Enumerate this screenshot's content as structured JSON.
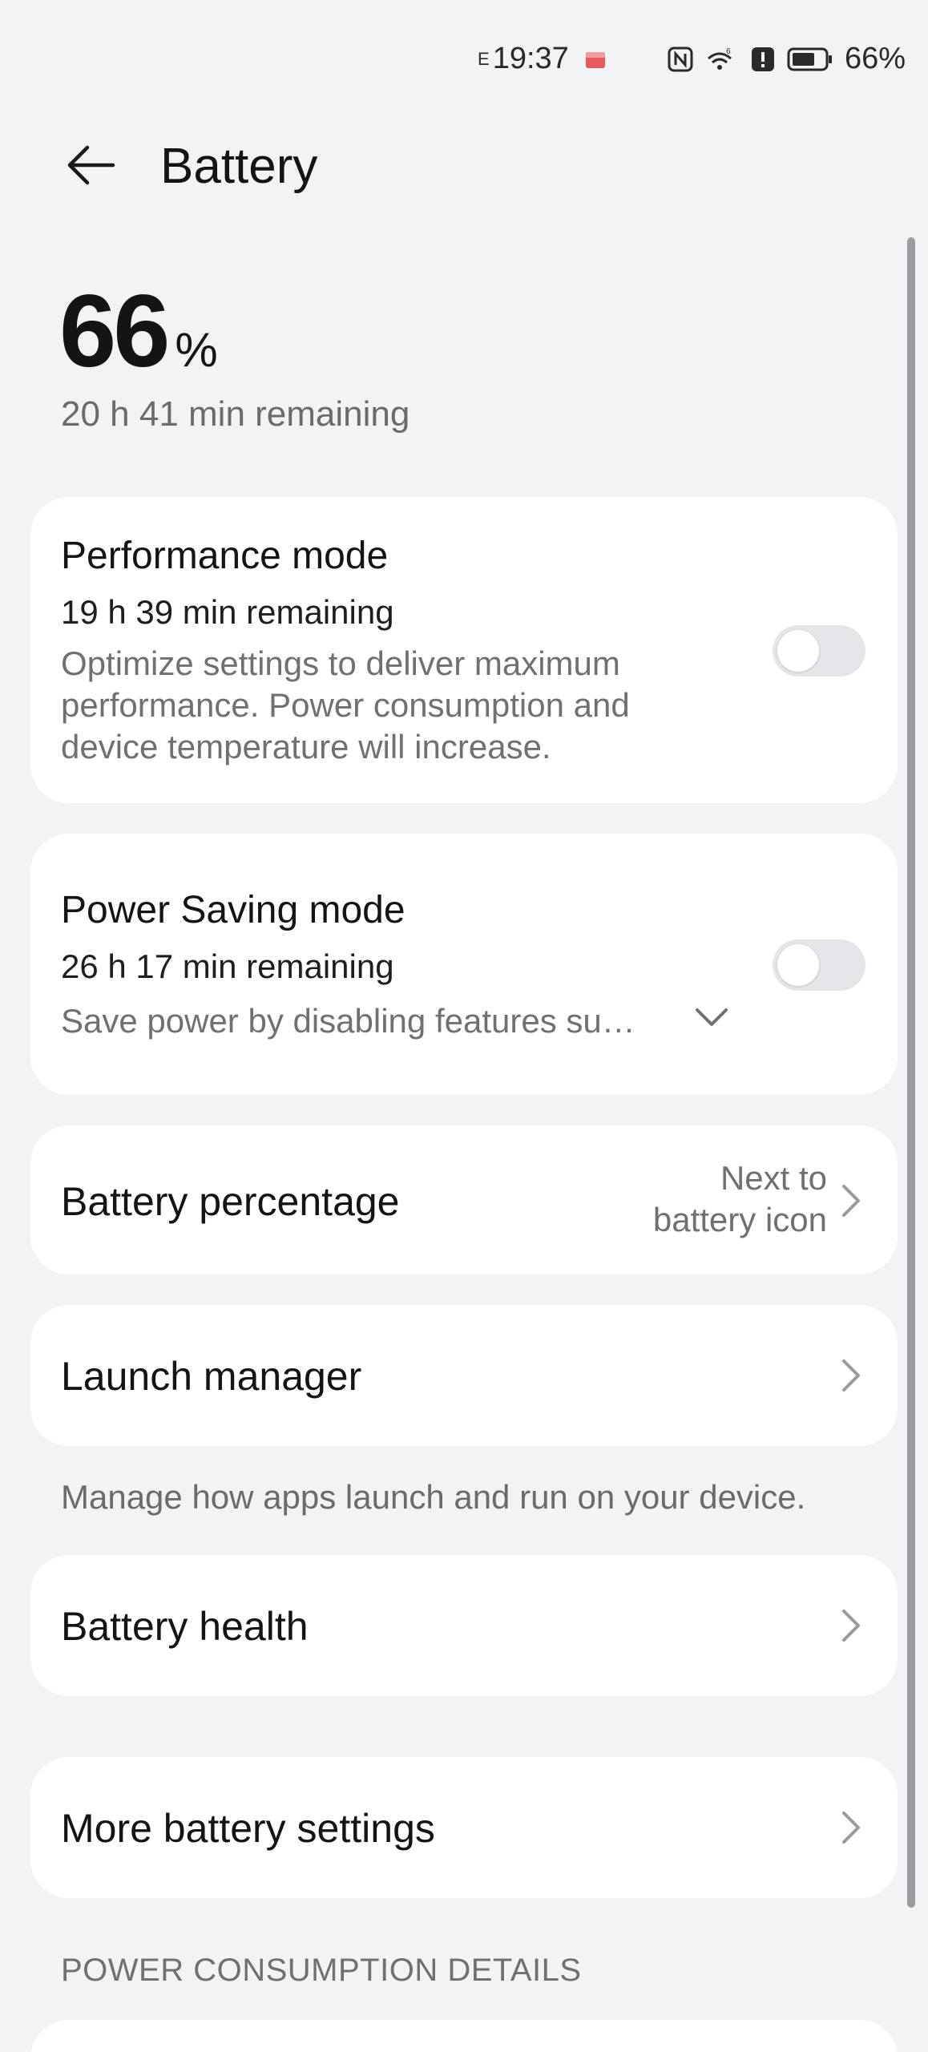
{
  "status_bar": {
    "network_mark": "E",
    "time": "19:37",
    "battery_percent": "66%"
  },
  "header": {
    "title": "Battery"
  },
  "summary": {
    "percent_value": "66",
    "percent_symbol": "%",
    "remaining": "20 h 41 min remaining"
  },
  "performance_mode": {
    "title": "Performance mode",
    "remaining": "19 h 39 min remaining",
    "desc_line1": "Optimize settings to deliver maximum",
    "desc_line2": "performance. Power consumption and",
    "desc_line3": "device temperature will increase.",
    "enabled": false
  },
  "power_saving_mode": {
    "title": "Power Saving mode",
    "remaining": "26 h 17 min remaining",
    "desc": "Save power by disabling features su…",
    "enabled": false
  },
  "battery_percentage": {
    "title": "Battery percentage",
    "value_line1": "Next to",
    "value_line2": "battery icon"
  },
  "launch_manager": {
    "title": "Launch manager",
    "note": "Manage how apps launch and run on your device."
  },
  "battery_health": {
    "title": "Battery health"
  },
  "more_settings": {
    "title": "More battery settings"
  },
  "power_consumption": {
    "header": "POWER CONSUMPTION DETAILS"
  },
  "colors": {
    "background": "#f1f3f5",
    "card": "#ffffff",
    "toggle_off": "#e3e5e8",
    "secondary_text": "#707070"
  }
}
